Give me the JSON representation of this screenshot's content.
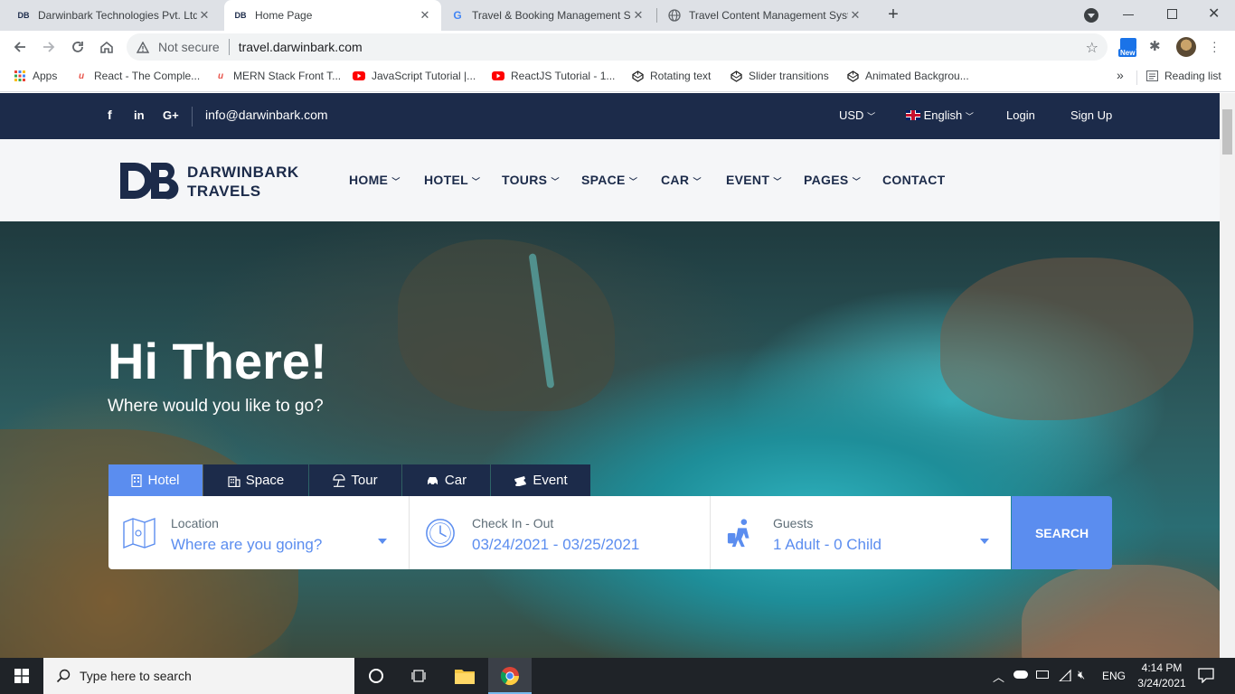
{
  "browser": {
    "tabs": [
      {
        "title": "Darwinbark Technologies Pvt. Ltd",
        "favicon": "DB"
      },
      {
        "title": "Home Page",
        "favicon": "DB"
      },
      {
        "title": "Travel & Booking Management S",
        "favicon": "G"
      },
      {
        "title": "Travel Content Management Syst",
        "favicon": "globe"
      }
    ],
    "new_tab": "+",
    "security_label": "Not secure",
    "url": "travel.darwinbark.com",
    "profile_badge": "New",
    "bookmarks": [
      {
        "label": "Apps"
      },
      {
        "label": "React - The Comple..."
      },
      {
        "label": "MERN Stack Front T..."
      },
      {
        "label": "JavaScript Tutorial |..."
      },
      {
        "label": "ReactJS Tutorial - 1..."
      },
      {
        "label": "Rotating text"
      },
      {
        "label": "Slider transitions"
      },
      {
        "label": "Animated Backgrou..."
      }
    ],
    "bookmarks_more": "»",
    "reading_list": "Reading list"
  },
  "site": {
    "topbar": {
      "social": [
        "f",
        "in",
        "G+"
      ],
      "email": "info@darwinbark.com",
      "currency": "USD",
      "language": "English",
      "login": "Login",
      "signup": "Sign Up"
    },
    "logo": {
      "line1": "DARWINBARK",
      "line2": "TRAVELS"
    },
    "nav": [
      "HOME",
      "HOTEL",
      "TOURS",
      "SPACE",
      "CAR",
      "EVENT",
      "PAGES",
      "CONTACT"
    ],
    "hero": {
      "title": "Hi There!",
      "subtitle": "Where would you like to go?"
    },
    "search_tabs": [
      "Hotel",
      "Space",
      "Tour",
      "Car",
      "Event"
    ],
    "search": {
      "location_label": "Location",
      "location_value": "Where are you going?",
      "dates_label": "Check In - Out",
      "dates_value": "03/24/2021 - 03/25/2021",
      "guests_label": "Guests",
      "guests_value": "1 Adult - 0 Child",
      "button": "SEARCH"
    }
  },
  "taskbar": {
    "search_placeholder": "Type here to search",
    "language": "ENG",
    "time": "4:14 PM",
    "date": "3/24/2021"
  },
  "colors": {
    "navy": "#1c2b4a",
    "accent": "#5b8def"
  }
}
